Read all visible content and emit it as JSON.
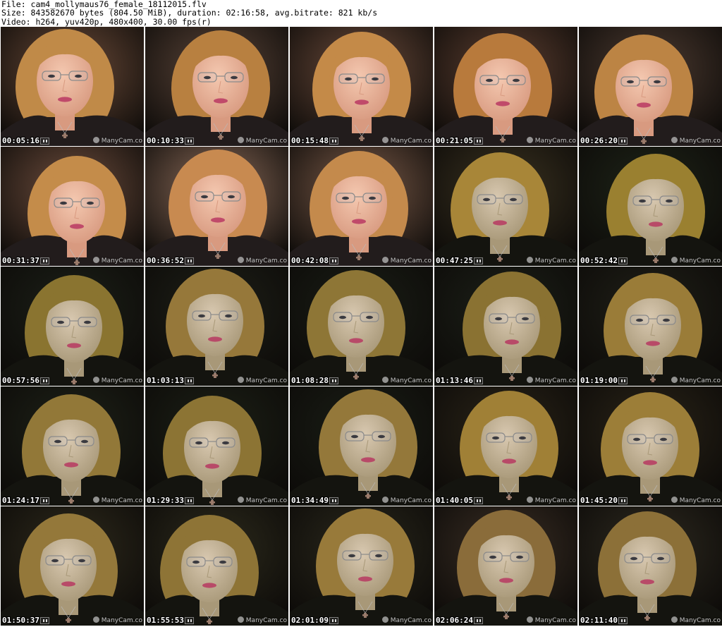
{
  "header": {
    "file_line": "File: cam4_mollymaus76_female_18112015.flv",
    "size_line": "Size: 843582670 bytes (804.50 MiB), duration: 02:16:58, avg.bitrate: 821 kb/s",
    "video_line": "Video: h264, yuv420p, 480x400, 30.00 fps(r)"
  },
  "watermark": "ManyCam.co",
  "frames": [
    {
      "time": "00:05:16",
      "bg": "#6a4a38",
      "tone": "warm",
      "hair": "#c08a48"
    },
    {
      "time": "00:10:33",
      "bg": "#5a4438",
      "tone": "warm",
      "hair": "#b88040"
    },
    {
      "time": "00:15:48",
      "bg": "#6a4a3a",
      "tone": "warm",
      "hair": "#c48a48"
    },
    {
      "time": "00:21:05",
      "bg": "#5c3e30",
      "tone": "warm",
      "hair": "#b87a3c"
    },
    {
      "time": "00:26:20",
      "bg": "#4c3a30",
      "tone": "warm",
      "hair": "#bc8444"
    },
    {
      "time": "00:31:37",
      "bg": "#6c4c3c",
      "tone": "warm",
      "hair": "#c48c4a"
    },
    {
      "time": "00:36:52",
      "bg": "#8a6a58",
      "tone": "warm",
      "hair": "#c88a50"
    },
    {
      "time": "00:42:08",
      "bg": "#7a5a48",
      "tone": "warm",
      "hair": "#c48a4c"
    },
    {
      "time": "00:47:25",
      "bg": "#3a3220",
      "tone": "olive",
      "hair": "#a88638"
    },
    {
      "time": "00:52:42",
      "bg": "#1e2418",
      "tone": "olive",
      "hair": "#9a8030"
    },
    {
      "time": "00:57:56",
      "bg": "#1c2018",
      "tone": "olive",
      "hair": "#8a7430"
    },
    {
      "time": "01:03:13",
      "bg": "#1e2018",
      "tone": "olive",
      "hair": "#96783a"
    },
    {
      "time": "01:08:28",
      "bg": "#1a1e16",
      "tone": "olive",
      "hair": "#8e7636"
    },
    {
      "time": "01:13:46",
      "bg": "#1c2018",
      "tone": "olive",
      "hair": "#8a7232"
    },
    {
      "time": "01:19:00",
      "bg": "#202018",
      "tone": "olive",
      "hair": "#9a7c38"
    },
    {
      "time": "01:24:17",
      "bg": "#1e2218",
      "tone": "olive",
      "hair": "#927838"
    },
    {
      "time": "01:29:33",
      "bg": "#1c2016",
      "tone": "olive",
      "hair": "#8c7434"
    },
    {
      "time": "01:34:49",
      "bg": "#1a1e16",
      "tone": "olive",
      "hair": "#94783a"
    },
    {
      "time": "01:40:05",
      "bg": "#2a2418",
      "tone": "olive",
      "hair": "#a08036"
    },
    {
      "time": "01:45:20",
      "bg": "#2a2418",
      "tone": "olive",
      "hair": "#9c7e38"
    },
    {
      "time": "01:50:37",
      "bg": "#2e2a1c",
      "tone": "olive",
      "hair": "#94783a"
    },
    {
      "time": "01:55:53",
      "bg": "#2c2a1c",
      "tone": "olive",
      "hair": "#8e7436"
    },
    {
      "time": "02:01:09",
      "bg": "#2a281c",
      "tone": "olive",
      "hair": "#987a3a"
    },
    {
      "time": "02:06:24",
      "bg": "#3a2e24",
      "tone": "olive",
      "hair": "#8a6c3a"
    },
    {
      "time": "02:11:40",
      "bg": "#2e2a20",
      "tone": "olive",
      "hair": "#8c7038"
    }
  ]
}
